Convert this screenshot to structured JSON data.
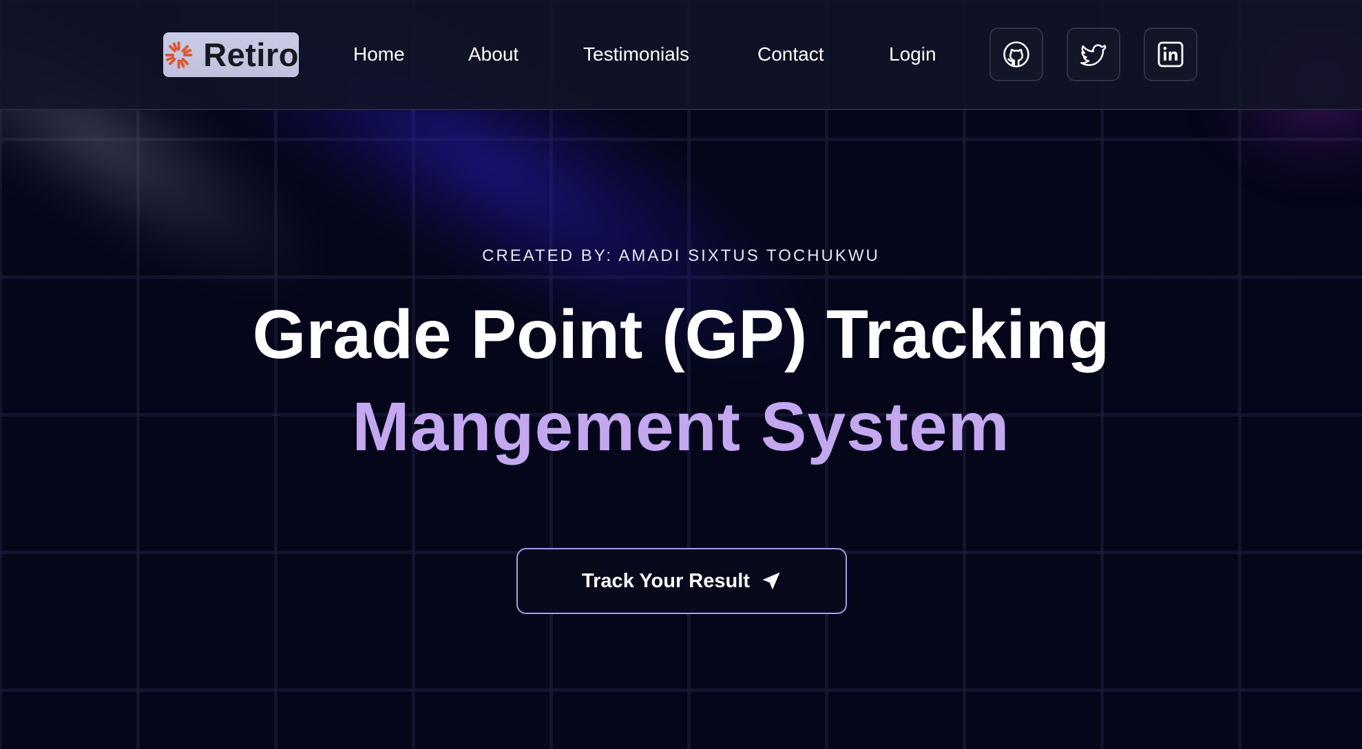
{
  "header": {
    "logo": {
      "text": "Retiro",
      "icon": "sunburst-logo-icon"
    },
    "nav": [
      {
        "label": "Home"
      },
      {
        "label": "About"
      },
      {
        "label": "Testimonials"
      },
      {
        "label": "Contact"
      },
      {
        "label": "Login"
      }
    ],
    "social": [
      {
        "icon": "github-icon"
      },
      {
        "icon": "twitter-icon"
      },
      {
        "icon": "linkedin-icon"
      }
    ]
  },
  "hero": {
    "eyebrow": "CREATED BY: AMADI SIXTUS TOCHUKWU",
    "title_line1": "Grade Point (GP) Tracking",
    "title_line2": "Mangement System",
    "cta": {
      "label": "Track Your Result",
      "icon": "paper-plane-icon"
    }
  },
  "colors": {
    "background": "#05061a",
    "header_bg": "#111426",
    "accent_purple": "#c3a8f0",
    "cta_border": "#a99ce6",
    "logo_bg": "#c9cbe6",
    "logo_mark": "#e2562a"
  }
}
